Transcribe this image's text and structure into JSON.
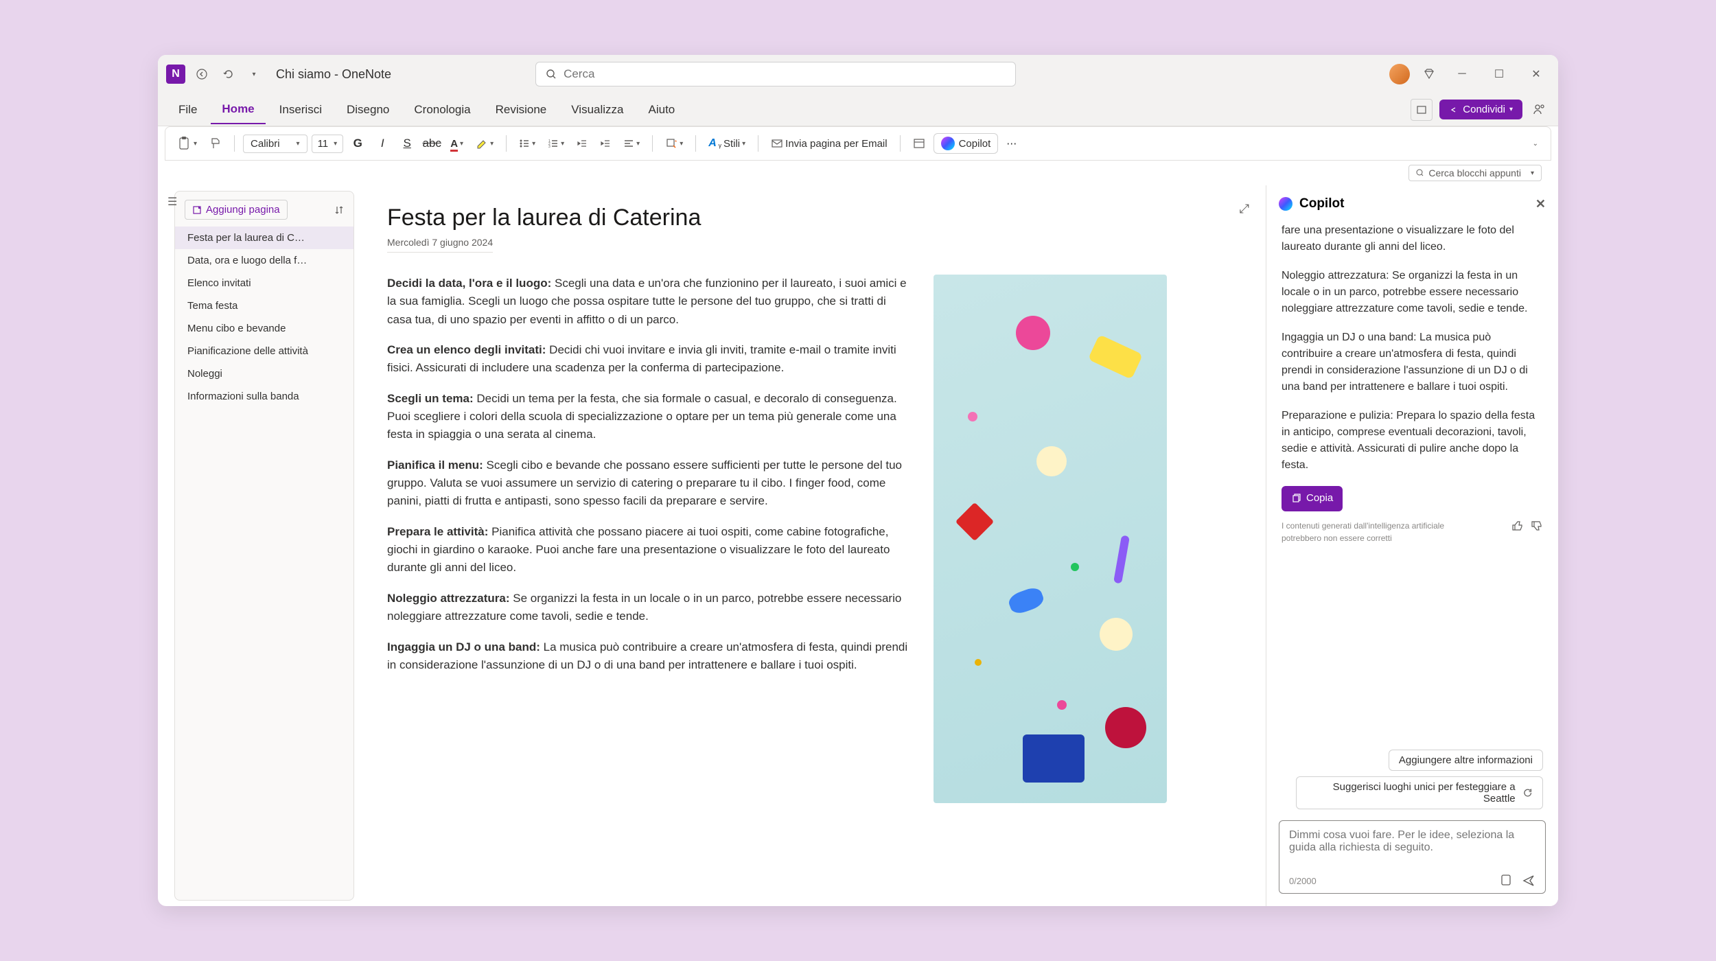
{
  "titlebar": {
    "title": "Chi siamo - OneNote",
    "search_placeholder": "Cerca"
  },
  "tabs": [
    "File",
    "Home",
    "Inserisci",
    "Disegno",
    "Cronologia",
    "Revisione",
    "Visualizza",
    "Aiuto"
  ],
  "share_label": "Condividi",
  "ribbon": {
    "font": "Calibri",
    "size": "11",
    "styles_label": "Stili",
    "email_label": "Invia pagina per Email",
    "copilot_label": "Copilot"
  },
  "sub_search": "Cerca blocchi appunti",
  "pagelist": {
    "add_label": "Aggiungi pagina",
    "items": [
      "Festa per la laurea di C…",
      "Data, ora e luogo della f…",
      "Elenco invitati",
      "Tema festa",
      "Menu cibo e bevande",
      "Pianificazione delle attività",
      "Noleggi",
      "Informazioni sulla banda"
    ]
  },
  "page": {
    "title": "Festa per la laurea di Caterina",
    "date": "Mercoledì 7 giugno 2024",
    "sections": [
      {
        "b": "Decidi la data, l'ora e il luogo:",
        "t": " Scegli una data e un'ora che funzionino per il laureato, i suoi amici e la sua famiglia. Scegli un luogo che possa ospitare tutte le persone del tuo gruppo, che si tratti di casa tua, di uno spazio per eventi in affitto o di un parco."
      },
      {
        "b": "Crea un elenco degli invitati:",
        "t": " Decidi chi vuoi invitare e invia gli inviti, tramite e-mail o tramite inviti fisici. Assicurati di includere una scadenza per la conferma di partecipazione."
      },
      {
        "b": "Scegli un tema:",
        "t": " Decidi un tema per la festa, che sia formale o casual, e decoralo di conseguenza. Puoi scegliere i colori della scuola di specializzazione o optare per un tema più generale come una festa in spiaggia o una serata al cinema."
      },
      {
        "b": "Pianifica il menu:",
        "t": " Scegli cibo e bevande che possano essere sufficienti per tutte le persone del tuo gruppo. Valuta se vuoi assumere un servizio di catering o preparare tu il cibo. I finger food, come panini, piatti di frutta e antipasti, sono spesso facili da preparare e servire."
      },
      {
        "b": "Prepara le attività:",
        "t": " Pianifica attività che possano piacere ai tuoi ospiti, come cabine fotografiche, giochi in giardino o karaoke. Puoi anche fare una presentazione o visualizzare le foto del laureato durante gli anni del liceo."
      },
      {
        "b": "Noleggio attrezzatura:",
        "t": " Se organizzi la festa in un locale o in un parco, potrebbe essere necessario noleggiare attrezzature come tavoli, sedie e tende."
      },
      {
        "b": "Ingaggia un DJ o una band:",
        "t": " La musica può contribuire a creare un'atmosfera di festa, quindi prendi in considerazione l'assunzione di un DJ o di una band per intrattenere e ballare i tuoi ospiti."
      }
    ]
  },
  "copilot": {
    "title": "Copilot",
    "paras": [
      "fare una presentazione o visualizzare le foto del laureato durante gli anni del liceo.",
      "Noleggio attrezzatura: Se organizzi la festa in un locale o in un parco, potrebbe essere necessario noleggiare attrezzature come tavoli, sedie e tende.",
      "Ingaggia un DJ o una band: La musica può contribuire a creare un'atmosfera di festa, quindi prendi in considerazione l'assunzione di un DJ o di una band per intrattenere e ballare i tuoi ospiti.",
      "Preparazione e pulizia: Prepara lo spazio della festa in anticipo, comprese eventuali decorazioni, tavoli, sedie e attività. Assicurati di pulire anche dopo la festa."
    ],
    "copy_label": "Copia",
    "disclaimer": "I contenuti generati dall'intelligenza artificiale potrebbero non essere corretti",
    "chips": [
      "Aggiungere altre informazioni",
      "Suggerisci luoghi unici per festeggiare a Seattle"
    ],
    "placeholder": "Dimmi cosa vuoi fare. Per le idee, seleziona la guida alla richiesta di seguito.",
    "counter": "0/2000"
  }
}
